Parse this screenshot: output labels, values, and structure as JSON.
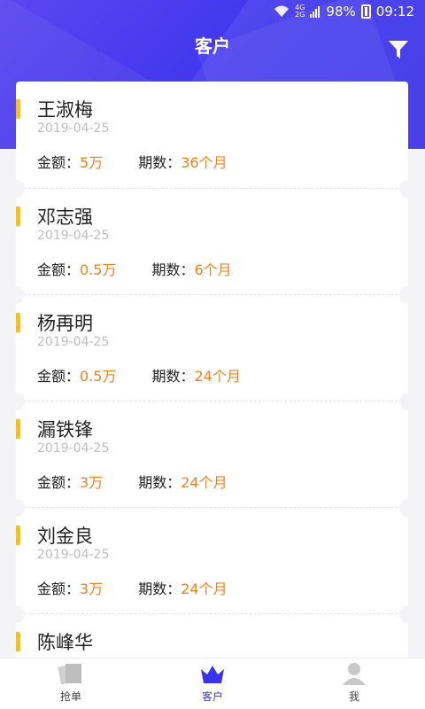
{
  "status_bar": {
    "battery": "98%",
    "time": "09:12",
    "net_top": "4G",
    "net_bottom": "2G"
  },
  "header": {
    "title": "客户"
  },
  "customers": [
    {
      "name": "王淑梅",
      "date": "2019-04-25",
      "amount_label": "金额：",
      "amount": "5万",
      "term_label": "期数：",
      "term": "36个月"
    },
    {
      "name": "邓志强",
      "date": "2019-04-25",
      "amount_label": "金额：",
      "amount": "0.5万",
      "term_label": "期数：",
      "term": "6个月"
    },
    {
      "name": "杨再明",
      "date": "2019-04-25",
      "amount_label": "金额：",
      "amount": "0.5万",
      "term_label": "期数：",
      "term": "24个月"
    },
    {
      "name": "漏铁锋",
      "date": "2019-04-25",
      "amount_label": "金额：",
      "amount": "3万",
      "term_label": "期数：",
      "term": "24个月"
    },
    {
      "name": "刘金良",
      "date": "2019-04-25",
      "amount_label": "金额：",
      "amount": "3万",
      "term_label": "期数：",
      "term": "24个月"
    },
    {
      "name": "陈峰华"
    }
  ],
  "tabs": [
    {
      "label": "抢单",
      "icon": "cards-icon"
    },
    {
      "label": "客户",
      "icon": "crown-icon",
      "active": true
    },
    {
      "label": "我",
      "icon": "user-icon"
    }
  ],
  "colors": {
    "accent": "#3c33ec",
    "value": "#f0811a",
    "marker": "#f6c21a"
  }
}
